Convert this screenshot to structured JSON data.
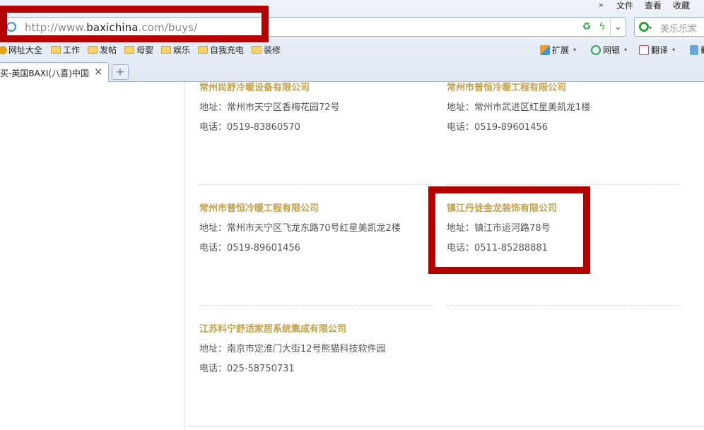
{
  "browser": {
    "menu": {
      "more": "»",
      "file": "文件",
      "view": "查看",
      "favorites": "收藏"
    },
    "url_prefix": "http://www.",
    "url_host": "baxichina",
    "url_rest": ".com/buys/",
    "search_text": "美乐乐家",
    "bookmarks": [
      "网址大全",
      "工作",
      "发帖",
      "母婴",
      "娱乐",
      "自我充电",
      "装修"
    ],
    "toolbar": {
      "extensions": "扩展",
      "netbank": "网银",
      "translate": "翻译",
      "more": "截"
    },
    "tab_title": "购买-英国BAXI(八喜)中国",
    "tab_close": "×",
    "new_tab": "+"
  },
  "companies": [
    {
      "name": "常州尚舒冷暖设备有限公司",
      "address": "地址：常州市天宁区香梅花园72号",
      "phone": "电话：0519-83860570"
    },
    {
      "name": "常州市普恒冷暖工程有限公司",
      "address": "地址：常州市武进区红星美凯龙1楼",
      "phone": "电话：0519-89601456"
    },
    {
      "name": "常州市普恒冷暖工程有限公司",
      "address": "地址：常州市天宁区飞龙东路70号红星美凯龙2楼",
      "phone": "电话：0519-89601456"
    },
    {
      "name": "镇江丹徒金龙装饰有限公司",
      "address": "地址：镇江市运河路78号",
      "phone": "电话：0511-85288881"
    },
    {
      "name": "江苏科宁舒适家居系统集成有限公司",
      "address": "地址：南京市定淮门大街12号熊猫科技软件园",
      "phone": "电话：025-58750731"
    }
  ],
  "colors": {
    "company_name": "#c3a14a",
    "annotation": "#b30000"
  }
}
